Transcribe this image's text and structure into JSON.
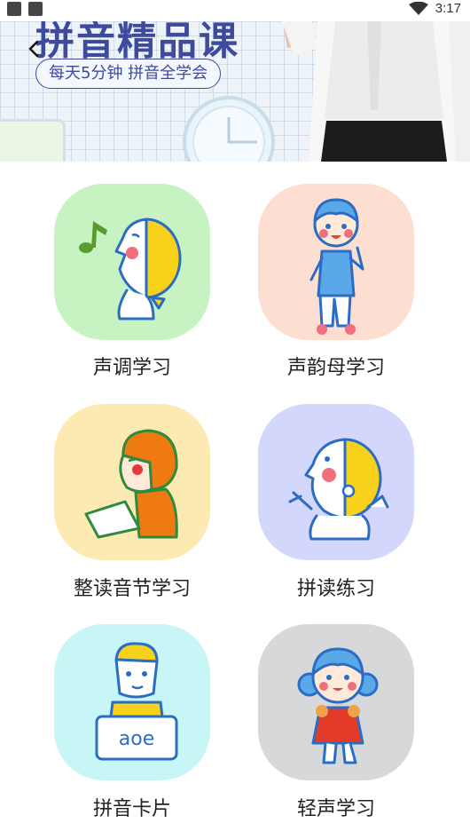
{
  "status_bar": {
    "time": "3:17"
  },
  "banner": {
    "title": "拼音精品课",
    "subtitle": "每天5分钟 拼音全学会"
  },
  "modules": [
    {
      "label": "声调学习",
      "bg": "#c7f3c3"
    },
    {
      "label": "声韵母学习",
      "bg": "#fddfd2"
    },
    {
      "label": "整读音节学习",
      "bg": "#fdeab2"
    },
    {
      "label": "拼读练习",
      "bg": "#d3d7fb"
    },
    {
      "label": "拼音卡片",
      "bg": "#c8f6f6"
    },
    {
      "label": "轻声学习",
      "bg": "#d7d8d9"
    }
  ],
  "card_text": "aoe"
}
